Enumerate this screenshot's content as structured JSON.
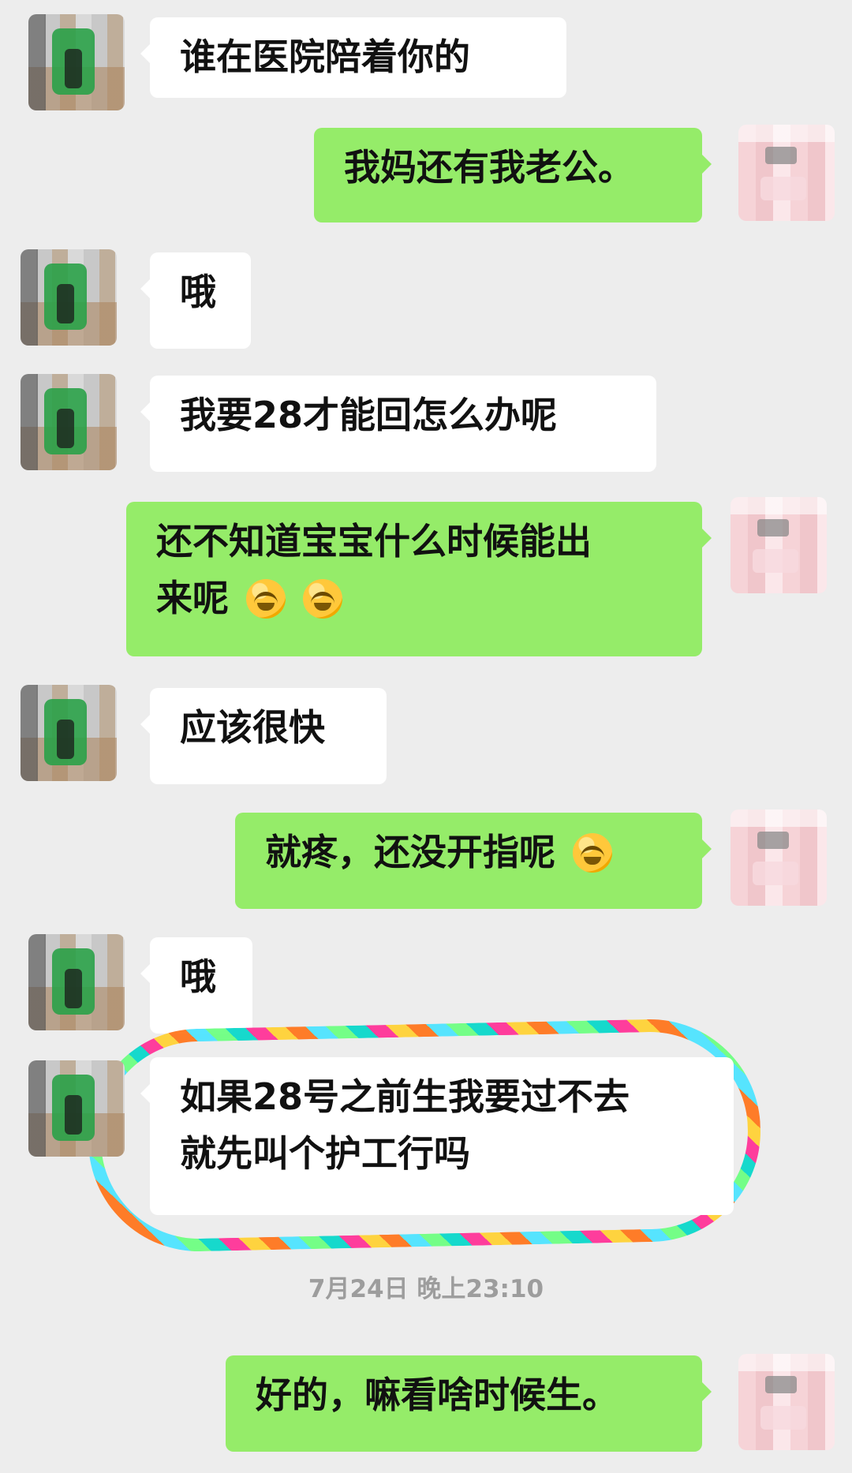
{
  "messages": [
    {
      "side": "left",
      "text": "谁在医院陪着你的"
    },
    {
      "side": "right",
      "text": "我妈还有我老公。"
    },
    {
      "side": "left",
      "text": "哦"
    },
    {
      "side": "left",
      "text": "我要28才能回怎么办呢"
    },
    {
      "side": "right",
      "text_line1": "还不知道宝宝什么时候能出",
      "text_line2": "来呢",
      "emoji_count": 2,
      "emoji_name": "crying-laughing-emoji"
    },
    {
      "side": "left",
      "text": "应该很快"
    },
    {
      "side": "right",
      "text": "就疼，还没开指呢",
      "emoji_count": 1,
      "emoji_name": "crying-laughing-emoji"
    },
    {
      "side": "left",
      "text": "哦"
    },
    {
      "side": "left",
      "text_line1": "如果28号之前生我要过不去",
      "text_line2": "就先叫个护工行吗",
      "highlighted": true
    }
  ],
  "timestamp": "7月24日 晚上23:10",
  "last_message": {
    "side": "right",
    "text": "好的，嘛看啥时候生。"
  },
  "colors": {
    "background": "#ededed",
    "left_bubble": "#ffffff",
    "right_bubble": "#95ec69",
    "timestamp_text": "#9d9d9d"
  }
}
